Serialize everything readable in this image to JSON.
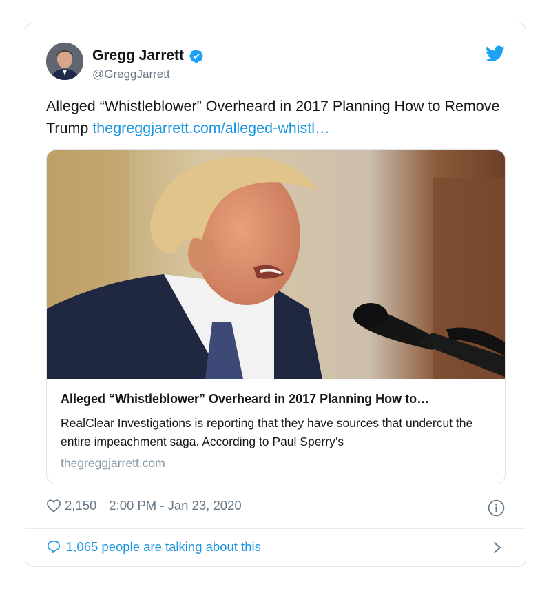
{
  "tweet": {
    "author_name": "Gregg Jarrett",
    "handle": "@GreggJarrett",
    "text": "Alleged “Whistleblower” Overheard in 2017 Planning How to Remove Trump",
    "link": "thegreggjarrett.com/alleged-whistl…",
    "likes": "2,150",
    "timestamp": "2:00 PM - Jan 23, 2020",
    "talking": "1,065 people are talking about this"
  },
  "card_preview": {
    "title": "Alleged “Whistleblower” Overheard in 2017 Planning How to…",
    "description": "RealClear Investigations is reporting that they have sources that undercut the entire impeachment saga. According to Paul Sperry’s",
    "domain": "thegreggjarrett.com"
  },
  "icons": [
    "verified-badge-icon",
    "twitter-bird-icon",
    "heart-icon",
    "info-icon",
    "speech-bubble-icon",
    "chevron-right-icon"
  ],
  "colors": {
    "accent": "#1b95e0",
    "muted": "#657786",
    "border": "#dfe3e7",
    "text": "#14171a"
  }
}
